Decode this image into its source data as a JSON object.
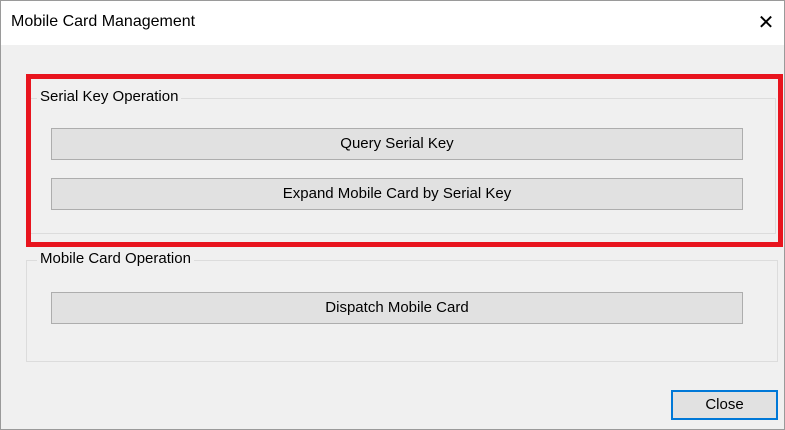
{
  "window": {
    "title": "Mobile Card Management",
    "close_glyph": "✕"
  },
  "serial_group": {
    "legend": "Serial Key Operation",
    "buttons": [
      {
        "label": "Query Serial Key"
      },
      {
        "label": "Expand Mobile Card by Serial Key"
      }
    ]
  },
  "mobile_group": {
    "legend": "Mobile Card Operation",
    "buttons": [
      {
        "label": "Dispatch Mobile Card"
      }
    ]
  },
  "footer": {
    "close_label": "Close"
  },
  "colors": {
    "highlight": "#e8141e",
    "focus_border": "#0078d7",
    "dialog_bg": "#f0f0f0"
  },
  "icons": {
    "title_close": "close-icon"
  }
}
